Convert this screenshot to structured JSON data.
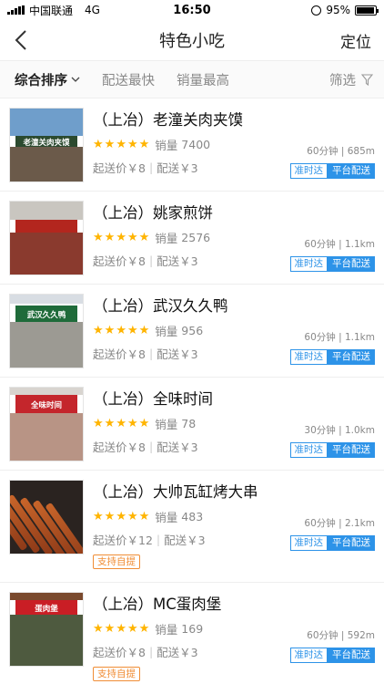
{
  "status_bar": {
    "carrier": "中国联通",
    "network": "4G",
    "time": "16:50",
    "battery": "95%",
    "battery_level": 0.95
  },
  "nav": {
    "title": "特色小吃",
    "right_action": "定位"
  },
  "filters": {
    "items": [
      {
        "label": "综合排序",
        "active": true
      },
      {
        "label": "配送最快",
        "active": false
      },
      {
        "label": "销量最高",
        "active": false
      }
    ],
    "right_label": "筛选"
  },
  "shops": [
    {
      "name": "（上冶）老潼关肉夹馍",
      "sales_label": "销量",
      "sales": "7400",
      "eta": "60分钟 | 685m",
      "min_price": "起送价￥8",
      "delivery_fee": "配送￥3",
      "tags": [
        "准时达",
        "平台配送"
      ],
      "pickup": "",
      "sign_text": "老潼关肉夹馍",
      "rating": 5
    },
    {
      "name": "（上冶）姚家煎饼",
      "sales_label": "销量",
      "sales": "2576",
      "eta": "60分钟 | 1.1km",
      "min_price": "起送价￥8",
      "delivery_fee": "配送￥3",
      "tags": [
        "准时达",
        "平台配送"
      ],
      "pickup": "",
      "sign_text": "",
      "rating": 5
    },
    {
      "name": "（上冶）武汉久久鸭",
      "sales_label": "销量",
      "sales": "956",
      "eta": "60分钟 | 1.1km",
      "min_price": "起送价￥8",
      "delivery_fee": "配送￥3",
      "tags": [
        "准时达",
        "平台配送"
      ],
      "pickup": "",
      "sign_text": "武汉久久鸭",
      "rating": 5
    },
    {
      "name": "（上冶）全味时间",
      "sales_label": "销量",
      "sales": "78",
      "eta": "30分钟 | 1.0km",
      "min_price": "起送价￥8",
      "delivery_fee": "配送￥3",
      "tags": [
        "准时达",
        "平台配送"
      ],
      "pickup": "",
      "sign_text": "全味时间",
      "rating": 5
    },
    {
      "name": "（上冶）大帅瓦缸烤大串",
      "sales_label": "销量",
      "sales": "483",
      "eta": "60分钟 | 2.1km",
      "min_price": "起送价￥12",
      "delivery_fee": "配送￥3",
      "tags": [
        "准时达",
        "平台配送"
      ],
      "pickup": "支持自提",
      "sign_text": "",
      "rating": 5
    },
    {
      "name": "（上冶）MC蛋肉堡",
      "sales_label": "销量",
      "sales": "169",
      "eta": "60分钟 | 592m",
      "min_price": "起送价￥8",
      "delivery_fee": "配送￥3",
      "tags": [
        "准时达",
        "平台配送"
      ],
      "pickup": "支持自提",
      "sign_text": "蛋肉堡",
      "rating": 5
    }
  ],
  "colors": {
    "accent": "#2d93e8",
    "star": "#ffb400",
    "pickup": "#f08d35"
  }
}
